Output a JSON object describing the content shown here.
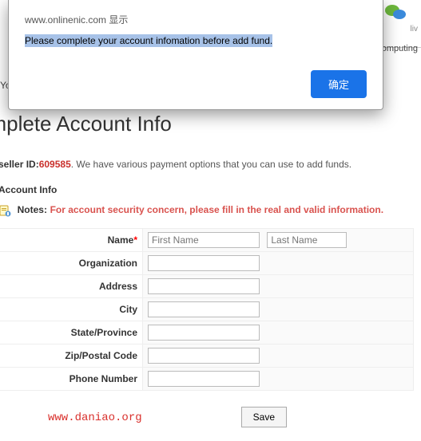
{
  "toprightLive": "liv",
  "toprightCloud": "id Computing",
  "leftYo": "Yo",
  "dialog": {
    "source": "www.onlinenic.com 显示",
    "message": "Please complete your account infomation before add fund.",
    "ok": "确定"
  },
  "page": {
    "title": "omplete Account Info",
    "resellerLabel": "seller ID:",
    "resellerId": "609585",
    "resellerTail": ". We have various payment options that you can use to add funds.",
    "sectionTitle": "Account Info",
    "notesLabel": "Notes:",
    "notesText": "For account security concern, please fill in the real and valid information."
  },
  "form": {
    "name": "Name",
    "firstNamePH": "First Name",
    "lastNamePH": "Last Name",
    "organization": "Organization",
    "address": "Address",
    "city": "City",
    "state": "State/Province",
    "zip": "Zip/Postal Code",
    "phone": "Phone Number",
    "save": "Save"
  },
  "watermark": "www.daniao.org"
}
